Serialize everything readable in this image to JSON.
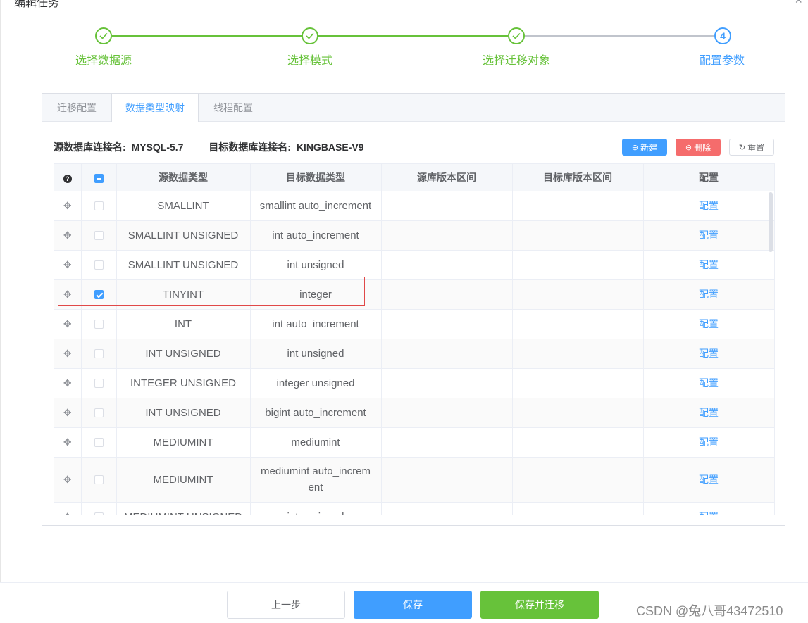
{
  "dialog": {
    "title": "编辑任务",
    "close": "×"
  },
  "steps": [
    {
      "title": "选择数据源",
      "status": "done",
      "number": ""
    },
    {
      "title": "选择模式",
      "status": "done",
      "number": ""
    },
    {
      "title": "选择迁移对象",
      "status": "done",
      "number": ""
    },
    {
      "title": "配置参数",
      "status": "active",
      "number": "4"
    }
  ],
  "tabs": [
    {
      "label": "迁移配置",
      "active": false
    },
    {
      "label": "数据类型映射",
      "active": true
    },
    {
      "label": "线程配置",
      "active": false
    }
  ],
  "connection": {
    "source_label": "源数据库连接名:",
    "source_value": "MYSQL-5.7",
    "target_label": "目标数据库连接名:",
    "target_value": "KINGBASE-V9"
  },
  "toolbar": {
    "new_label": "新建",
    "delete_label": "删除",
    "reset_label": "重置"
  },
  "table": {
    "help_symbol": "?",
    "columns": [
      "源数据类型",
      "目标数据类型",
      "源库版本区间",
      "目标库版本区间",
      "配置"
    ],
    "rows": [
      {
        "source": "SMALLINT",
        "target": "smallint auto_increment",
        "src_ver": "",
        "tgt_ver": "",
        "action": "配置",
        "checked": false
      },
      {
        "source": "SMALLINT UNSIGNED",
        "target": "int auto_increment",
        "src_ver": "",
        "tgt_ver": "",
        "action": "配置",
        "checked": false
      },
      {
        "source": "SMALLINT UNSIGNED",
        "target": "int unsigned",
        "src_ver": "",
        "tgt_ver": "",
        "action": "配置",
        "checked": false
      },
      {
        "source": "TINYINT",
        "target": "integer",
        "src_ver": "",
        "tgt_ver": "",
        "action": "配置",
        "checked": true
      },
      {
        "source": "INT",
        "target": "int auto_increment",
        "src_ver": "",
        "tgt_ver": "",
        "action": "配置",
        "checked": false
      },
      {
        "source": "INT UNSIGNED",
        "target": "int unsigned",
        "src_ver": "",
        "tgt_ver": "",
        "action": "配置",
        "checked": false
      },
      {
        "source": "INTEGER UNSIGNED",
        "target": "integer unsigned",
        "src_ver": "",
        "tgt_ver": "",
        "action": "配置",
        "checked": false
      },
      {
        "source": "INT UNSIGNED",
        "target": "bigint auto_increment",
        "src_ver": "",
        "tgt_ver": "",
        "action": "配置",
        "checked": false
      },
      {
        "source": "MEDIUMINT",
        "target": "mediumint",
        "src_ver": "",
        "tgt_ver": "",
        "action": "配置",
        "checked": false
      },
      {
        "source": "MEDIUMINT",
        "target": "mediumint auto_increm ent",
        "src_ver": "",
        "tgt_ver": "",
        "action": "配置",
        "checked": false
      },
      {
        "source": "MEDIUMINT UNSIGNED",
        "target": "int unsigned",
        "src_ver": "",
        "tgt_ver": "",
        "action": "配置",
        "checked": false
      }
    ]
  },
  "footer": {
    "prev_label": "上一步",
    "save_label": "保存",
    "save_migrate_label": "保存并迁移",
    "watermark": "CSDN @兔八哥43472510"
  },
  "colors": {
    "primary": "#409eff",
    "success": "#67c23a",
    "danger": "#f56c6c",
    "highlight": "#e04848"
  }
}
